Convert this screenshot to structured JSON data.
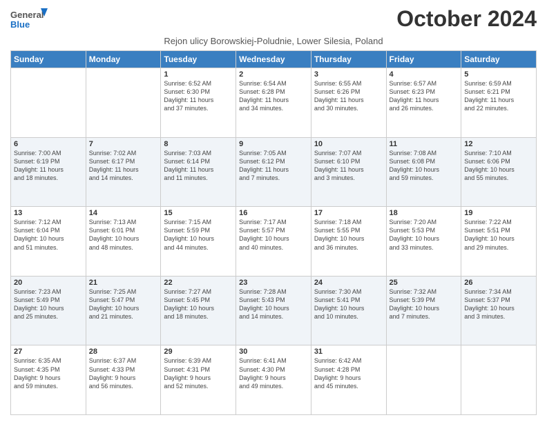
{
  "logo": {
    "line1": "General",
    "line2": "Blue"
  },
  "title": "October 2024",
  "subtitle": "Rejon ulicy Borowskiej-Poludnie, Lower Silesia, Poland",
  "days_header": [
    "Sunday",
    "Monday",
    "Tuesday",
    "Wednesday",
    "Thursday",
    "Friday",
    "Saturday"
  ],
  "weeks": [
    [
      {
        "day": "",
        "info": ""
      },
      {
        "day": "",
        "info": ""
      },
      {
        "day": "1",
        "info": "Sunrise: 6:52 AM\nSunset: 6:30 PM\nDaylight: 11 hours\nand 37 minutes."
      },
      {
        "day": "2",
        "info": "Sunrise: 6:54 AM\nSunset: 6:28 PM\nDaylight: 11 hours\nand 34 minutes."
      },
      {
        "day": "3",
        "info": "Sunrise: 6:55 AM\nSunset: 6:26 PM\nDaylight: 11 hours\nand 30 minutes."
      },
      {
        "day": "4",
        "info": "Sunrise: 6:57 AM\nSunset: 6:23 PM\nDaylight: 11 hours\nand 26 minutes."
      },
      {
        "day": "5",
        "info": "Sunrise: 6:59 AM\nSunset: 6:21 PM\nDaylight: 11 hours\nand 22 minutes."
      }
    ],
    [
      {
        "day": "6",
        "info": "Sunrise: 7:00 AM\nSunset: 6:19 PM\nDaylight: 11 hours\nand 18 minutes."
      },
      {
        "day": "7",
        "info": "Sunrise: 7:02 AM\nSunset: 6:17 PM\nDaylight: 11 hours\nand 14 minutes."
      },
      {
        "day": "8",
        "info": "Sunrise: 7:03 AM\nSunset: 6:14 PM\nDaylight: 11 hours\nand 11 minutes."
      },
      {
        "day": "9",
        "info": "Sunrise: 7:05 AM\nSunset: 6:12 PM\nDaylight: 11 hours\nand 7 minutes."
      },
      {
        "day": "10",
        "info": "Sunrise: 7:07 AM\nSunset: 6:10 PM\nDaylight: 11 hours\nand 3 minutes."
      },
      {
        "day": "11",
        "info": "Sunrise: 7:08 AM\nSunset: 6:08 PM\nDaylight: 10 hours\nand 59 minutes."
      },
      {
        "day": "12",
        "info": "Sunrise: 7:10 AM\nSunset: 6:06 PM\nDaylight: 10 hours\nand 55 minutes."
      }
    ],
    [
      {
        "day": "13",
        "info": "Sunrise: 7:12 AM\nSunset: 6:04 PM\nDaylight: 10 hours\nand 51 minutes."
      },
      {
        "day": "14",
        "info": "Sunrise: 7:13 AM\nSunset: 6:01 PM\nDaylight: 10 hours\nand 48 minutes."
      },
      {
        "day": "15",
        "info": "Sunrise: 7:15 AM\nSunset: 5:59 PM\nDaylight: 10 hours\nand 44 minutes."
      },
      {
        "day": "16",
        "info": "Sunrise: 7:17 AM\nSunset: 5:57 PM\nDaylight: 10 hours\nand 40 minutes."
      },
      {
        "day": "17",
        "info": "Sunrise: 7:18 AM\nSunset: 5:55 PM\nDaylight: 10 hours\nand 36 minutes."
      },
      {
        "day": "18",
        "info": "Sunrise: 7:20 AM\nSunset: 5:53 PM\nDaylight: 10 hours\nand 33 minutes."
      },
      {
        "day": "19",
        "info": "Sunrise: 7:22 AM\nSunset: 5:51 PM\nDaylight: 10 hours\nand 29 minutes."
      }
    ],
    [
      {
        "day": "20",
        "info": "Sunrise: 7:23 AM\nSunset: 5:49 PM\nDaylight: 10 hours\nand 25 minutes."
      },
      {
        "day": "21",
        "info": "Sunrise: 7:25 AM\nSunset: 5:47 PM\nDaylight: 10 hours\nand 21 minutes."
      },
      {
        "day": "22",
        "info": "Sunrise: 7:27 AM\nSunset: 5:45 PM\nDaylight: 10 hours\nand 18 minutes."
      },
      {
        "day": "23",
        "info": "Sunrise: 7:28 AM\nSunset: 5:43 PM\nDaylight: 10 hours\nand 14 minutes."
      },
      {
        "day": "24",
        "info": "Sunrise: 7:30 AM\nSunset: 5:41 PM\nDaylight: 10 hours\nand 10 minutes."
      },
      {
        "day": "25",
        "info": "Sunrise: 7:32 AM\nSunset: 5:39 PM\nDaylight: 10 hours\nand 7 minutes."
      },
      {
        "day": "26",
        "info": "Sunrise: 7:34 AM\nSunset: 5:37 PM\nDaylight: 10 hours\nand 3 minutes."
      }
    ],
    [
      {
        "day": "27",
        "info": "Sunrise: 6:35 AM\nSunset: 4:35 PM\nDaylight: 9 hours\nand 59 minutes."
      },
      {
        "day": "28",
        "info": "Sunrise: 6:37 AM\nSunset: 4:33 PM\nDaylight: 9 hours\nand 56 minutes."
      },
      {
        "day": "29",
        "info": "Sunrise: 6:39 AM\nSunset: 4:31 PM\nDaylight: 9 hours\nand 52 minutes."
      },
      {
        "day": "30",
        "info": "Sunrise: 6:41 AM\nSunset: 4:30 PM\nDaylight: 9 hours\nand 49 minutes."
      },
      {
        "day": "31",
        "info": "Sunrise: 6:42 AM\nSunset: 4:28 PM\nDaylight: 9 hours\nand 45 minutes."
      },
      {
        "day": "",
        "info": ""
      },
      {
        "day": "",
        "info": ""
      }
    ]
  ]
}
